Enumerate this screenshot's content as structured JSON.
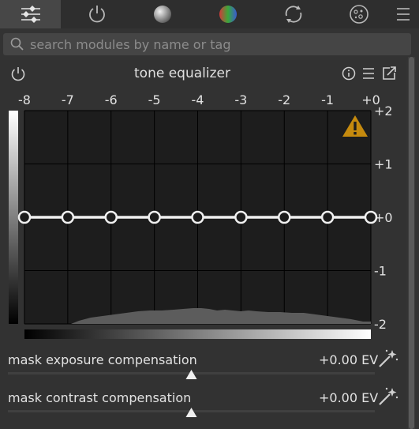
{
  "tabs": [
    {
      "icon": "sliders-icon",
      "active": true
    },
    {
      "icon": "power-icon",
      "active": false
    },
    {
      "icon": "grey-sphere-icon",
      "active": false
    },
    {
      "icon": "color-sphere-icon",
      "active": false
    },
    {
      "icon": "circular-arrows-icon",
      "active": false
    },
    {
      "icon": "effects-sphere-icon",
      "active": false
    },
    {
      "icon": "hamburger-menu-icon",
      "active": false
    }
  ],
  "search": {
    "placeholder": "search modules by name or tag"
  },
  "module": {
    "title": "tone equalizer"
  },
  "chart_data": {
    "type": "line",
    "x_tick_labels": [
      "-8",
      "-7",
      "-6",
      "-5",
      "-4",
      "-3",
      "-2",
      "-1",
      "+0"
    ],
    "y_tick_labels": [
      "+2",
      "+1",
      "+0",
      "-1",
      "-2"
    ],
    "x": [
      -8,
      -7,
      -6,
      -5,
      -4,
      -3,
      -2,
      -1,
      0
    ],
    "values": [
      0,
      0,
      0,
      0,
      0,
      0,
      0,
      0,
      0
    ],
    "xlim": [
      -8,
      0
    ],
    "ylim": [
      -2,
      2
    ],
    "grid": true,
    "warning_icon": "warning-icon"
  },
  "sliders": [
    {
      "label": "mask exposure compensation",
      "value": "+0.00 EV",
      "position": 0.5
    },
    {
      "label": "mask contrast compensation",
      "value": "+0.00 EV",
      "position": 0.5
    }
  ],
  "colors": {
    "accent": "#b8860b",
    "background": "#333333",
    "curve": "#f0f0f0"
  }
}
